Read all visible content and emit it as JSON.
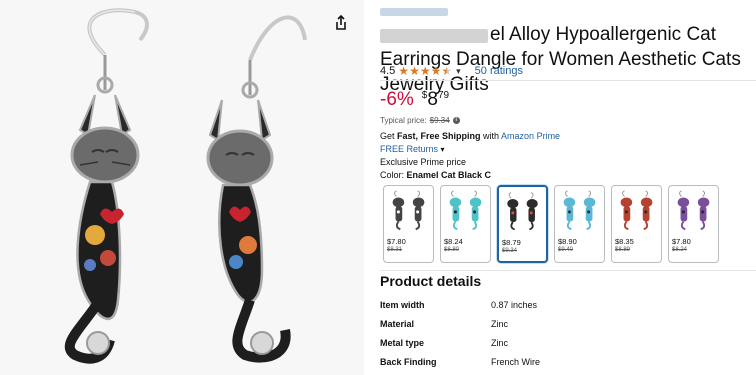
{
  "product": {
    "title": "el Alloy Hypoallergenic Cat Earrings Dangle for Women Aesthetic Cats Jewelry Gifts",
    "rating_value": "4.5",
    "ratings_count": "50 ratings",
    "stars_filled": 4.5,
    "discount": "-6%",
    "price_symbol": "$",
    "price_whole": "8",
    "price_fraction": "79",
    "typical_label": "Typical price:",
    "typical_price": "$9.34",
    "shipping_prefix": "Get ",
    "shipping_bold": "Fast, Free Shipping",
    "shipping_mid": " with ",
    "shipping_link": "Amazon Prime",
    "free_returns": "FREE Returns",
    "exclusive": "Exclusive Prime price",
    "color_label": "Color: ",
    "color_value": "Enamel Cat Black C"
  },
  "swatches": [
    {
      "price": "$7.80",
      "was": "$8.31",
      "color": "#444444",
      "accent": "#ffffff"
    },
    {
      "price": "$8.24",
      "was": "$8.80",
      "color": "#4fc3c7",
      "accent": "#2b2b2b"
    },
    {
      "price": "$8.79",
      "was": "$9.34",
      "color": "#2b2b2b",
      "accent": "#d4553a"
    },
    {
      "price": "$8.90",
      "was": "$9.40",
      "color": "#5ab7d6",
      "accent": "#333333"
    },
    {
      "price": "$8.35",
      "was": "$8.89",
      "color": "#b5432f",
      "accent": "#2b2b2b"
    },
    {
      "price": "$7.80",
      "was": "$8.24",
      "color": "#7a4f9c",
      "accent": "#2b2b2b"
    }
  ],
  "details": {
    "heading": "Product details",
    "rows": [
      {
        "key": "Item width",
        "value": "0.87 inches"
      },
      {
        "key": "Material",
        "value": "Zinc"
      },
      {
        "key": "Metal type",
        "value": "Zinc"
      },
      {
        "key": "Back Finding",
        "value": "French Wire"
      }
    ]
  },
  "colors": {
    "link": "#2162a1",
    "discount": "#cc0c39",
    "star": "#de7921"
  }
}
